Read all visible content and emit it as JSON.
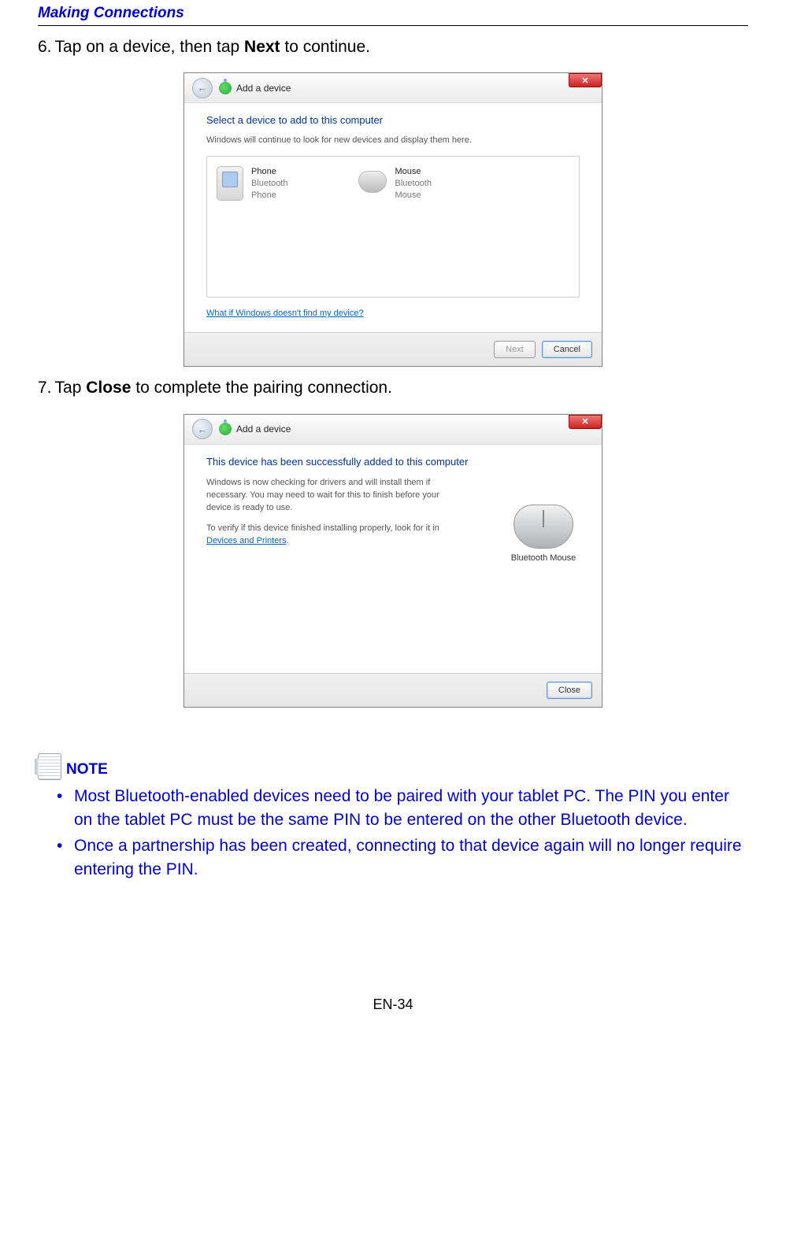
{
  "header": "Making Connections",
  "step6": {
    "num": "6.",
    "text_before": "Tap on a device, then tap ",
    "bold": "Next",
    "text_after": " to continue."
  },
  "dialog1": {
    "title": "Add a device",
    "heading": "Select a device to add to this computer",
    "subtext": "Windows will continue to look for new devices and display them here.",
    "devices": [
      {
        "name": "Phone",
        "line2": "Bluetooth",
        "line3": "Phone"
      },
      {
        "name": "Mouse",
        "line2": "Bluetooth",
        "line3": "Mouse"
      }
    ],
    "help_link": "What if Windows doesn't find my device?",
    "btn_next": "Next",
    "btn_cancel": "Cancel"
  },
  "step7": {
    "num": "7.",
    "text_before": "Tap ",
    "bold": "Close",
    "text_after": " to complete the pairing connection."
  },
  "dialog2": {
    "title": "Add a device",
    "heading": "This device has been successfully added to this computer",
    "p1": "Windows is now checking for drivers and will install them if necessary. You may need to wait for this to finish before your device is ready to use.",
    "p2a": "To verify if this device finished installing properly, look for it in ",
    "link": "Devices and Printers",
    "p2b": ".",
    "device_caption": "Bluetooth Mouse",
    "btn_close": "Close"
  },
  "note": {
    "label": "NOTE",
    "items": [
      "Most Bluetooth-enabled devices need to be paired with your tablet PC. The PIN you enter on the tablet PC must be the same PIN to be entered on the other Bluetooth device.",
      "Once a partnership has been created, connecting to that device again will no longer require entering the PIN."
    ]
  },
  "footer": "EN-34"
}
